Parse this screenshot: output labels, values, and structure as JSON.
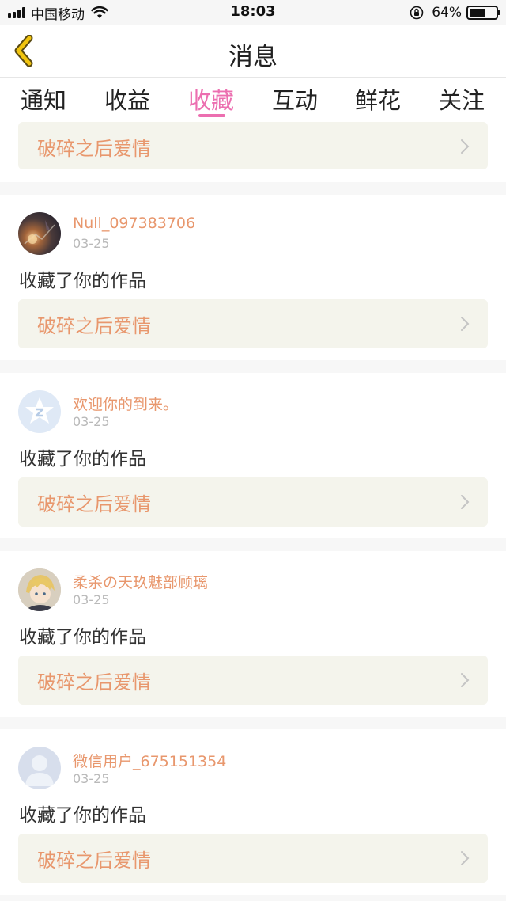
{
  "status_bar": {
    "carrier": "中国移动",
    "time": "18:03",
    "battery_pct": "64%",
    "battery_level": 0.64
  },
  "nav": {
    "title": "消息"
  },
  "tabs": [
    {
      "label": "通知"
    },
    {
      "label": "收益"
    },
    {
      "label": "收藏"
    },
    {
      "label": "互动"
    },
    {
      "label": "鲜花"
    },
    {
      "label": "关注"
    }
  ],
  "active_tab": "收藏",
  "feed": {
    "top_partial_card": {
      "work_title": "破碎之后爱情"
    },
    "items": [
      {
        "username": "Null_097383706",
        "date": "03-25",
        "action": "收藏了你的作品",
        "work_title": "破碎之后爱情",
        "avatar": "dark-fantasy-art-avatar"
      },
      {
        "username": "欢迎你的到来。",
        "date": "03-25",
        "action": "收藏了你的作品",
        "work_title": "破碎之后爱情",
        "avatar": "default-star-avatar"
      },
      {
        "username": "柔杀の天玖魅部顾璃",
        "date": "03-25",
        "action": "收藏了你的作品",
        "work_title": "破碎之后爱情",
        "avatar": "anime-character-avatar"
      },
      {
        "username": "微信用户_675151354",
        "date": "03-25",
        "action": "收藏了你的作品",
        "work_title": "破碎之后爱情",
        "avatar": "default-person-avatar"
      }
    ]
  },
  "colors": {
    "accent_pink": "#ec6fb0",
    "username_orange": "#e8976d",
    "card_bg": "#f4f4ec",
    "back_arrow_yellow": "#f1c40f"
  }
}
